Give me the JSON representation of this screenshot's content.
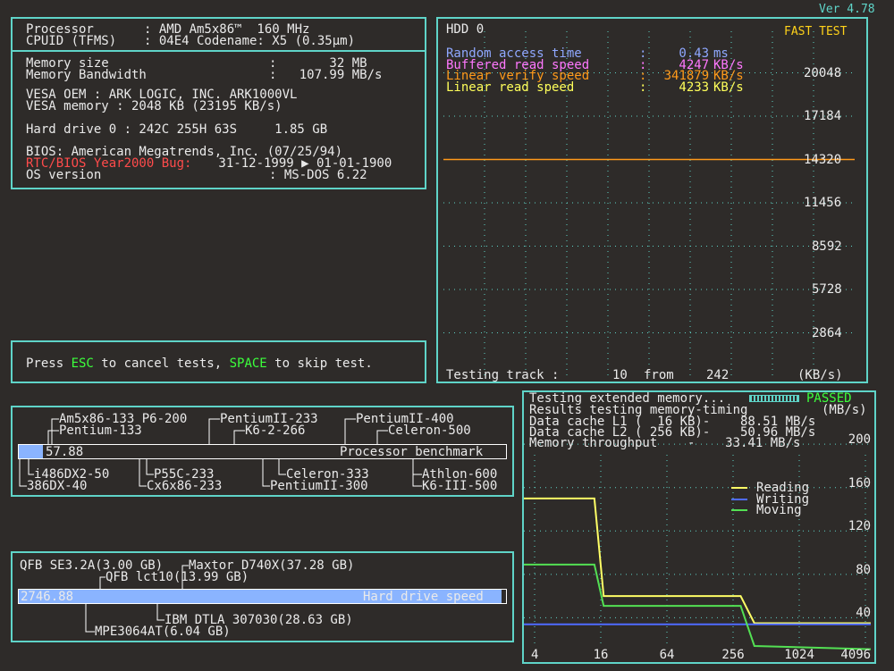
{
  "version": "Ver 4.78",
  "sysinfo": {
    "processor_label": "Processor",
    "processor_value": ": AMD Am5x86™  160 MHz",
    "cpuid_label": "CPUID (TFMS)",
    "cpuid_value": ": 04E4 Codename: X5 (0.35µm)",
    "memsize_label": "Memory size",
    "memsize_value": ":       32 MB",
    "membw_label": "Memory Bandwidth",
    "membw_value": ":   107.99 MB/s",
    "vesa_oem": "VESA OEM : ARK LOGIC, INC. ARK1000VL",
    "vesa_mem": "VESA memory : 2048 KB (23195 KB/s)",
    "hdd0": "Hard drive 0 : 242C 255H 63S     1.85 GB",
    "bios": "BIOS: American Megatrends, Inc. (07/25/94)",
    "y2k_label": "RTC/BIOS Year2000 Bug:",
    "y2k_value": " 31-12-1999 ▶ 01-01-1900",
    "os_label": "OS version",
    "os_value": ": MS-DOS 6.22"
  },
  "hint": {
    "pre": "Press ",
    "esc": "ESC",
    "mid": " to cancel tests, ",
    "space": "SPACE",
    "post": " to skip test."
  },
  "hdd_test": {
    "title": "HDD 0",
    "mode": "FAST TEST",
    "lines": [
      {
        "label": "Random access time",
        "value": "0.43",
        "unit": "ms",
        "color": "#8fa8ff"
      },
      {
        "label": "Buffered read speed",
        "value": "4247",
        "unit": "KB/s",
        "color": "#ff78ff"
      },
      {
        "label": "Linear verify speed",
        "value": "341879",
        "unit": "KB/s",
        "color": "#ff9a1a"
      },
      {
        "label": "Linear read speed",
        "value": "4233",
        "unit": "KB/s",
        "color": "#ffff5a"
      }
    ],
    "y_ticks": [
      "20048",
      "17184",
      "14320",
      "11456",
      "8592",
      "5728",
      "2864"
    ],
    "status_left": "Testing track :",
    "status_track": "10",
    "status_from": "from",
    "status_total": "242",
    "status_unit": "(KB/s)",
    "line_value": 14320,
    "line_color": "#ff9a1a"
  },
  "mem_test": {
    "line1": "Testing extended memory...",
    "passed": "PASSED",
    "line2": "Results testing memory-timing",
    "unit": "(MB/s)",
    "l1": "Data cache L1 (  16 KB)-    88.51 MB/s",
    "l2": "Data cache L2 ( 256 KB)-    50.96 MB/s",
    "throughput": "Memory throughput    -    33.41 MB/s",
    "legend": [
      {
        "name": "Reading",
        "color": "#ffff66"
      },
      {
        "name": "Writing",
        "color": "#4f6bff"
      },
      {
        "name": "Moving",
        "color": "#53e053"
      }
    ],
    "y_ticks": [
      "200",
      "160",
      "120",
      "80",
      "40"
    ],
    "x_ticks": [
      "4",
      "16",
      "64",
      "256",
      "1024",
      "4096"
    ]
  },
  "cpu_bench": {
    "value": "57.88",
    "bar_label": "Processor benchmark",
    "top_refs": [
      "Am5x86-133 P6-200",
      "Pentium-133",
      "PentiumII-233",
      "K6-2-266",
      "PentiumII-400",
      "Celeron-500"
    ],
    "bottom_refs": [
      "i486DX2-50",
      "386DX-40",
      "P55C-233",
      "Cx6x86-233",
      "Celeron-333",
      "PentiumII-300",
      "Athlon-600",
      "K6-III-500"
    ],
    "fill_fraction": 0.05
  },
  "hdd_bench": {
    "value": "2746.88",
    "bar_label": "Hard drive speed",
    "top_refs": [
      "QFB SE3.2A(3.00 GB)",
      "Maxtor D740X(37.28 GB)",
      "QFB lct10(13.99 GB)"
    ],
    "bottom_refs": [
      "IBM DTLA 307030(28.63 GB)",
      "MPE3064AT(6.04 GB)"
    ],
    "fill_fraction": 0.99
  },
  "chart_data": [
    {
      "type": "line",
      "title": "HDD 0",
      "ylabel": "(KB/s)",
      "ylim": [
        0,
        22912
      ],
      "y_ticks": [
        2864,
        5728,
        8592,
        11456,
        14320,
        17184,
        20048
      ],
      "series": [
        {
          "name": "Linear verify speed",
          "x": [
            0,
            242
          ],
          "values": [
            14320,
            14320
          ]
        }
      ]
    },
    {
      "type": "line",
      "ylabel": "(MB/s)",
      "xscale": "log",
      "ylim": [
        0,
        210
      ],
      "x_ticks": [
        4,
        16,
        64,
        256,
        1024,
        4096
      ],
      "y_ticks": [
        40,
        80,
        120,
        160,
        200
      ],
      "series": [
        {
          "name": "Reading",
          "x": [
            1,
            14,
            17,
            300,
            400,
            8192
          ],
          "values": [
            150,
            150,
            60,
            60,
            35,
            35
          ]
        },
        {
          "name": "Writing",
          "x": [
            1,
            8192
          ],
          "values": [
            34,
            34
          ]
        },
        {
          "name": "Moving",
          "x": [
            1,
            14,
            17,
            300,
            400,
            8192
          ],
          "values": [
            89,
            89,
            51,
            51,
            14,
            11
          ]
        }
      ]
    }
  ]
}
